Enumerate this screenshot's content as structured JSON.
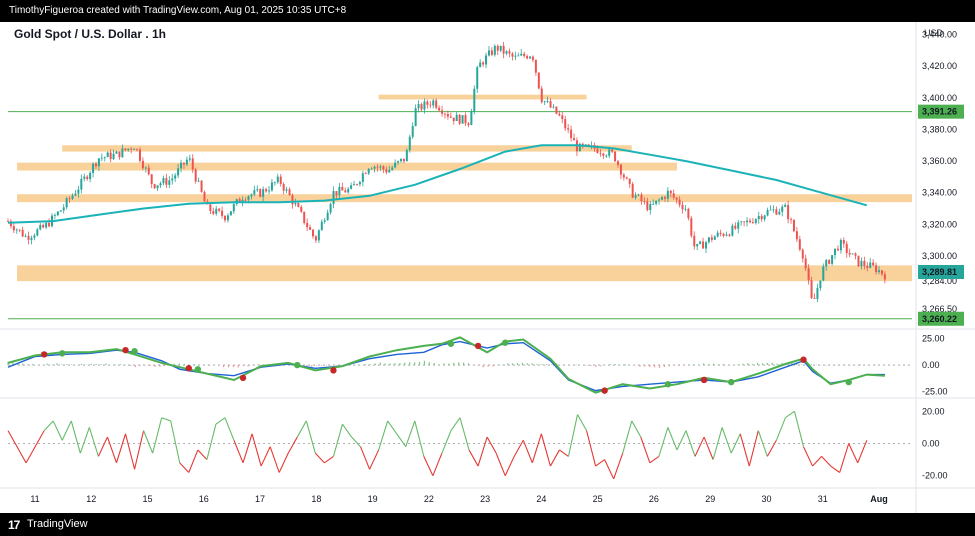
{
  "header": {
    "caption": "TimothyFigueroa created with TradingView.com, Aug 01, 2025 10:35 UTC+8"
  },
  "footer": {
    "brand": "TradingView",
    "logo": "tradingview-logo-icon"
  },
  "colors": {
    "bull": "#26a69a",
    "bear": "#ef5350",
    "ma": "#1ab3b8",
    "zone": "#f7c98a",
    "green_osc": "#4caf50",
    "red_osc": "#c62828",
    "blue_osc": "#1e63d6",
    "hline": "#4caf50"
  },
  "chart_data": [
    {
      "type": "candlestick",
      "title": "Gold Spot / U.S. Dollar . 1h",
      "currency": "USD",
      "ylim": [
        3255,
        3448
      ],
      "y_ticks": [
        "3,440.00",
        "3,420.00",
        "3,400.00",
        "3,380.00",
        "3,360.00",
        "3,340.00",
        "3,320.00",
        "3,300.00",
        "3,284.00",
        "3,266.50"
      ],
      "y_tick_values": [
        3440,
        3420,
        3400,
        3380,
        3360,
        3340,
        3320,
        3300,
        3284,
        3266.5
      ],
      "x_ticks": [
        "11",
        "12",
        "15",
        "16",
        "17",
        "18",
        "19",
        "22",
        "23",
        "24",
        "25",
        "26",
        "29",
        "30",
        "31",
        "Aug"
      ],
      "price_markers": [
        {
          "label": "3,391.26",
          "value": 3391.26,
          "color": "#4caf50"
        },
        {
          "label": "3,289.81",
          "value": 3289.81,
          "color": "#26a69a"
        },
        {
          "label": "3,260.22",
          "value": 3260.22,
          "color": "#4caf50"
        }
      ],
      "horizontal_lines": [
        3391.26,
        3260.22
      ],
      "zones": [
        {
          "from": 3399,
          "to": 3402,
          "x_start": 0.41,
          "x_end": 0.64
        },
        {
          "from": 3366,
          "to": 3370,
          "x_start": 0.06,
          "x_end": 0.69
        },
        {
          "from": 3354,
          "to": 3359,
          "x_start": 0.01,
          "x_end": 0.74
        },
        {
          "from": 3334,
          "to": 3339,
          "x_start": 0.01,
          "x_end": 1.0
        },
        {
          "from": 3284,
          "to": 3294,
          "x_start": 0.01,
          "x_end": 1.0
        }
      ],
      "close_path": [
        [
          0,
          3322
        ],
        [
          0.02,
          3312
        ],
        [
          0.04,
          3318
        ],
        [
          0.06,
          3330
        ],
        [
          0.08,
          3345
        ],
        [
          0.1,
          3362
        ],
        [
          0.12,
          3364
        ],
        [
          0.14,
          3370
        ],
        [
          0.16,
          3345
        ],
        [
          0.18,
          3348
        ],
        [
          0.2,
          3362
        ],
        [
          0.22,
          3330
        ],
        [
          0.24,
          3325
        ],
        [
          0.26,
          3338
        ],
        [
          0.28,
          3340
        ],
        [
          0.3,
          3348
        ],
        [
          0.32,
          3330
        ],
        [
          0.34,
          3310
        ],
        [
          0.36,
          3340
        ],
        [
          0.38,
          3342
        ],
        [
          0.4,
          3358
        ],
        [
          0.42,
          3354
        ],
        [
          0.44,
          3362
        ],
        [
          0.45,
          3392
        ],
        [
          0.47,
          3398
        ],
        [
          0.49,
          3388
        ],
        [
          0.51,
          3385
        ],
        [
          0.52,
          3420
        ],
        [
          0.54,
          3432
        ],
        [
          0.56,
          3425
        ],
        [
          0.58,
          3428
        ],
        [
          0.59,
          3400
        ],
        [
          0.61,
          3388
        ],
        [
          0.63,
          3368
        ],
        [
          0.65,
          3368
        ],
        [
          0.67,
          3364
        ],
        [
          0.69,
          3340
        ],
        [
          0.71,
          3330
        ],
        [
          0.73,
          3340
        ],
        [
          0.75,
          3330
        ],
        [
          0.76,
          3304
        ],
        [
          0.78,
          3312
        ],
        [
          0.8,
          3316
        ],
        [
          0.82,
          3322
        ],
        [
          0.84,
          3328
        ],
        [
          0.86,
          3330
        ],
        [
          0.88,
          3300
        ],
        [
          0.89,
          3268
        ],
        [
          0.9,
          3290
        ],
        [
          0.92,
          3308
        ],
        [
          0.94,
          3296
        ],
        [
          0.96,
          3292
        ],
        [
          0.97,
          3288
        ]
      ],
      "ma_path": [
        [
          0,
          3321
        ],
        [
          0.05,
          3322
        ],
        [
          0.1,
          3326
        ],
        [
          0.15,
          3330
        ],
        [
          0.2,
          3333
        ],
        [
          0.25,
          3334
        ],
        [
          0.3,
          3334
        ],
        [
          0.35,
          3335
        ],
        [
          0.4,
          3338
        ],
        [
          0.45,
          3345
        ],
        [
          0.5,
          3355
        ],
        [
          0.55,
          3366
        ],
        [
          0.59,
          3370
        ],
        [
          0.63,
          3370
        ],
        [
          0.67,
          3368
        ],
        [
          0.71,
          3364
        ],
        [
          0.75,
          3360
        ],
        [
          0.8,
          3354
        ],
        [
          0.85,
          3348
        ],
        [
          0.9,
          3340
        ],
        [
          0.95,
          3332
        ]
      ]
    },
    {
      "type": "line",
      "indicator": "oscillator-1",
      "ylim": [
        -30,
        32
      ],
      "y_ticks": [
        "25.00",
        "0.00",
        "-25.00"
      ],
      "y_tick_values": [
        25,
        0,
        -25
      ],
      "series": [
        {
          "color": "#1e63d6",
          "values": [
            [
              0,
              -2
            ],
            [
              0.03,
              8
            ],
            [
              0.06,
              10
            ],
            [
              0.09,
              11
            ],
            [
              0.12,
              14
            ],
            [
              0.14,
              12
            ],
            [
              0.17,
              4
            ],
            [
              0.19,
              -4
            ],
            [
              0.22,
              -8
            ],
            [
              0.25,
              -10
            ],
            [
              0.28,
              -2
            ],
            [
              0.31,
              1
            ],
            [
              0.34,
              -3
            ],
            [
              0.37,
              -1
            ],
            [
              0.4,
              6
            ],
            [
              0.43,
              10
            ],
            [
              0.46,
              12
            ],
            [
              0.48,
              19
            ],
            [
              0.5,
              22
            ],
            [
              0.53,
              16
            ],
            [
              0.55,
              20
            ],
            [
              0.57,
              21
            ],
            [
              0.6,
              4
            ],
            [
              0.62,
              -14
            ],
            [
              0.65,
              -24
            ],
            [
              0.68,
              -20
            ],
            [
              0.71,
              -18
            ],
            [
              0.74,
              -16
            ],
            [
              0.77,
              -14
            ],
            [
              0.8,
              -16
            ],
            [
              0.83,
              -11
            ],
            [
              0.86,
              -2
            ],
            [
              0.88,
              4
            ],
            [
              0.89,
              -6
            ],
            [
              0.91,
              -17
            ],
            [
              0.93,
              -14
            ],
            [
              0.95,
              -9
            ],
            [
              0.97,
              -9
            ]
          ]
        },
        {
          "color": "#4caf50",
          "values": [
            [
              0,
              2
            ],
            [
              0.03,
              9
            ],
            [
              0.06,
              12
            ],
            [
              0.09,
              12
            ],
            [
              0.12,
              15
            ],
            [
              0.14,
              10
            ],
            [
              0.17,
              2
            ],
            [
              0.19,
              -2
            ],
            [
              0.22,
              -8
            ],
            [
              0.25,
              -14
            ],
            [
              0.28,
              -1
            ],
            [
              0.31,
              2
            ],
            [
              0.34,
              -5
            ],
            [
              0.37,
              -1
            ],
            [
              0.4,
              8
            ],
            [
              0.43,
              14
            ],
            [
              0.46,
              18
            ],
            [
              0.48,
              20
            ],
            [
              0.5,
              26
            ],
            [
              0.53,
              12
            ],
            [
              0.55,
              22
            ],
            [
              0.57,
              24
            ],
            [
              0.6,
              6
            ],
            [
              0.62,
              -13
            ],
            [
              0.65,
              -26
            ],
            [
              0.68,
              -18
            ],
            [
              0.71,
              -22
            ],
            [
              0.74,
              -18
            ],
            [
              0.77,
              -12
            ],
            [
              0.8,
              -16
            ],
            [
              0.83,
              -8
            ],
            [
              0.86,
              1
            ],
            [
              0.88,
              6
            ],
            [
              0.89,
              -4
            ],
            [
              0.91,
              -18
            ],
            [
              0.93,
              -14
            ],
            [
              0.95,
              -9
            ],
            [
              0.97,
              -10
            ]
          ]
        }
      ]
    },
    {
      "type": "line",
      "indicator": "oscillator-2",
      "ylim": [
        -27,
        27
      ],
      "y_ticks": [
        "20.00",
        "0.00",
        "-20.00"
      ],
      "y_tick_values": [
        20,
        0,
        -20
      ],
      "values": [
        [
          0,
          8
        ],
        [
          0.02,
          -12
        ],
        [
          0.04,
          8
        ],
        [
          0.05,
          14
        ],
        [
          0.06,
          2
        ],
        [
          0.07,
          14
        ],
        [
          0.08,
          -6
        ],
        [
          0.09,
          10
        ],
        [
          0.1,
          -8
        ],
        [
          0.11,
          4
        ],
        [
          0.12,
          -12
        ],
        [
          0.13,
          6
        ],
        [
          0.14,
          -16
        ],
        [
          0.15,
          8
        ],
        [
          0.16,
          -6
        ],
        [
          0.17,
          16
        ],
        [
          0.18,
          14
        ],
        [
          0.19,
          -12
        ],
        [
          0.2,
          -18
        ],
        [
          0.21,
          -4
        ],
        [
          0.22,
          -10
        ],
        [
          0.23,
          12
        ],
        [
          0.24,
          16
        ],
        [
          0.25,
          2
        ],
        [
          0.26,
          -12
        ],
        [
          0.27,
          6
        ],
        [
          0.28,
          -14
        ],
        [
          0.29,
          -2
        ],
        [
          0.3,
          -18
        ],
        [
          0.31,
          -6
        ],
        [
          0.32,
          4
        ],
        [
          0.33,
          14
        ],
        [
          0.34,
          -6
        ],
        [
          0.35,
          -12
        ],
        [
          0.36,
          -8
        ],
        [
          0.37,
          12
        ],
        [
          0.38,
          4
        ],
        [
          0.39,
          -2
        ],
        [
          0.4,
          -16
        ],
        [
          0.41,
          -4
        ],
        [
          0.42,
          14
        ],
        [
          0.43,
          6
        ],
        [
          0.44,
          -2
        ],
        [
          0.45,
          14
        ],
        [
          0.46,
          -8
        ],
        [
          0.47,
          -20
        ],
        [
          0.48,
          -6
        ],
        [
          0.49,
          8
        ],
        [
          0.5,
          16
        ],
        [
          0.51,
          -4
        ],
        [
          0.52,
          -14
        ],
        [
          0.53,
          4
        ],
        [
          0.54,
          -6
        ],
        [
          0.55,
          -20
        ],
        [
          0.56,
          -8
        ],
        [
          0.57,
          2
        ],
        [
          0.58,
          -12
        ],
        [
          0.59,
          6
        ],
        [
          0.6,
          -14
        ],
        [
          0.61,
          -4
        ],
        [
          0.62,
          -8
        ],
        [
          0.63,
          18
        ],
        [
          0.64,
          8
        ],
        [
          0.65,
          -14
        ],
        [
          0.66,
          -10
        ],
        [
          0.67,
          -22
        ],
        [
          0.68,
          -6
        ],
        [
          0.69,
          14
        ],
        [
          0.7,
          4
        ],
        [
          0.71,
          -12
        ],
        [
          0.72,
          -8
        ],
        [
          0.73,
          10
        ],
        [
          0.74,
          -4
        ],
        [
          0.75,
          8
        ],
        [
          0.76,
          -8
        ],
        [
          0.77,
          4
        ],
        [
          0.78,
          -10
        ],
        [
          0.79,
          10
        ],
        [
          0.8,
          -6
        ],
        [
          0.81,
          6
        ],
        [
          0.82,
          -14
        ],
        [
          0.83,
          8
        ],
        [
          0.84,
          -8
        ],
        [
          0.85,
          2
        ],
        [
          0.86,
          16
        ],
        [
          0.87,
          20
        ],
        [
          0.88,
          -2
        ],
        [
          0.89,
          -14
        ],
        [
          0.9,
          -8
        ],
        [
          0.91,
          -14
        ],
        [
          0.92,
          -18
        ],
        [
          0.93,
          0
        ],
        [
          0.94,
          -12
        ],
        [
          0.95,
          2
        ]
      ]
    }
  ]
}
